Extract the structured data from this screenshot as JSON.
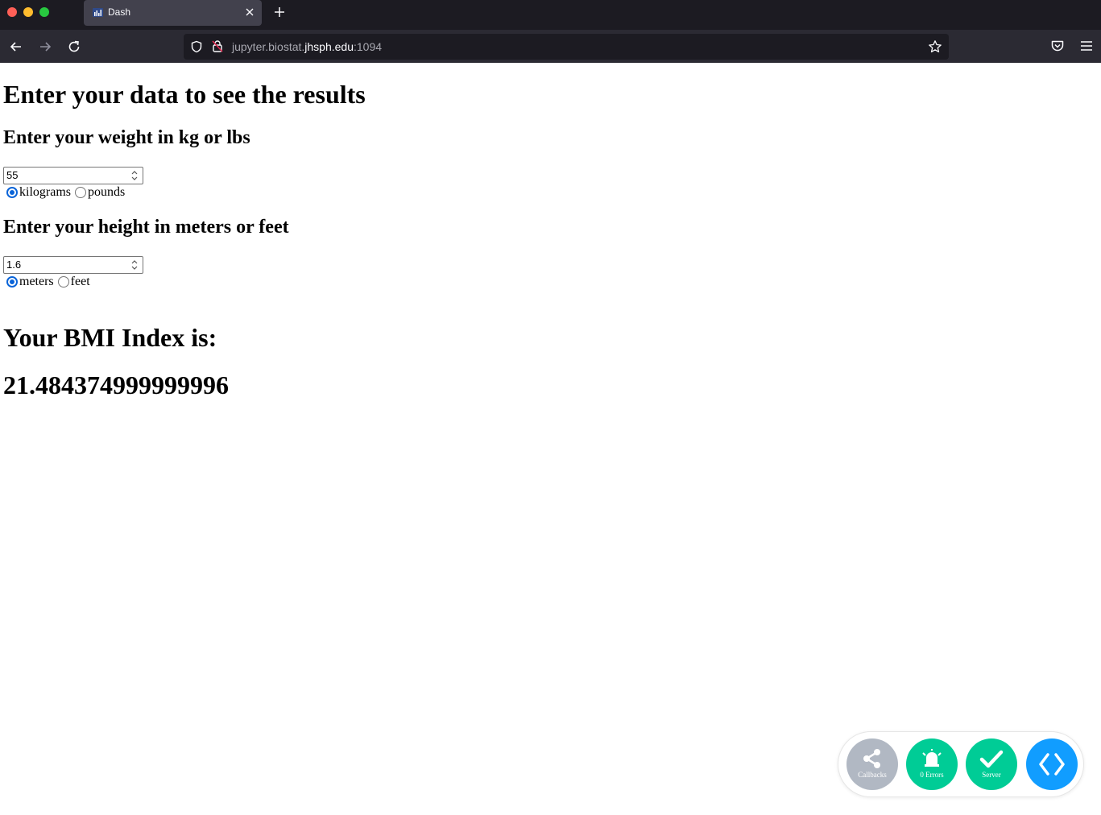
{
  "browser": {
    "tab_title": "Dash",
    "url_dim_prefix": "jupyter.biostat.",
    "url_domain": "jhsph.edu",
    "url_port": ":1094"
  },
  "page": {
    "main_heading": "Enter your data to see the results",
    "weight": {
      "heading": "Enter your weight in kg or lbs",
      "value": "55",
      "units": [
        {
          "label": "kilograms",
          "selected": true
        },
        {
          "label": "pounds",
          "selected": false
        }
      ]
    },
    "height": {
      "heading": "Enter your height in meters or feet",
      "value": "1.6",
      "units": [
        {
          "label": "meters",
          "selected": true
        },
        {
          "label": "feet",
          "selected": false
        }
      ]
    },
    "bmi_heading": "Your BMI Index is:",
    "bmi_value": "21.484374999999996"
  },
  "debug_menu": {
    "callbacks_label": "Callbacks",
    "errors_label": "0 Errors",
    "server_label": "Server",
    "colors": {
      "callbacks": "#b1b8c3",
      "ok": "#00cc96",
      "toggle": "#119dff"
    }
  }
}
